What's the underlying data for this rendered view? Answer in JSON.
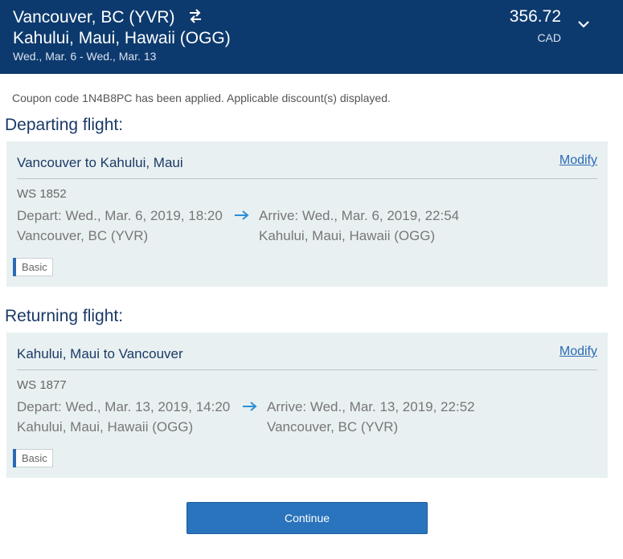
{
  "header": {
    "origin": "Vancouver, BC (YVR)",
    "destination": "Kahului, Maui, Hawaii (OGG)",
    "dates": "Wed., Mar. 6 - Wed., Mar. 13",
    "price": "356.72",
    "currency": "CAD",
    "icons": {
      "swap": "swap-arrows-icon",
      "expand": "chevron-down-icon"
    }
  },
  "coupon_message": "Coupon code 1N4B8PC has been applied. Applicable discount(s) displayed.",
  "departing": {
    "section_title": "Departing flight:",
    "card_title": "Vancouver to Kahului, Maui",
    "modify_label": "Modify",
    "flight_number": "WS 1852",
    "depart": "Depart: Wed., Mar. 6, 2019, 18:20",
    "depart_location": "Vancouver, BC (YVR)",
    "arrive": "Arrive: Wed., Mar. 6, 2019, 22:54",
    "arrive_location": "Kahului, Maui, Hawaii (OGG)",
    "fare": "Basic"
  },
  "returning": {
    "section_title": "Returning flight:",
    "card_title": "Kahului, Maui to Vancouver",
    "modify_label": "Modify",
    "flight_number": "WS 1877",
    "depart": "Depart: Wed., Mar. 13, 2019, 14:20",
    "depart_location": "Kahului, Maui, Hawaii (OGG)",
    "arrive": "Arrive: Wed., Mar. 13, 2019, 22:52",
    "arrive_location": "Vancouver, BC (YVR)",
    "fare": "Basic"
  },
  "continue_label": "Continue",
  "colors": {
    "header_bg": "#0d3a6e",
    "card_bg": "#e9f0f1",
    "accent": "#2a73bd",
    "title": "#1a3a66"
  }
}
